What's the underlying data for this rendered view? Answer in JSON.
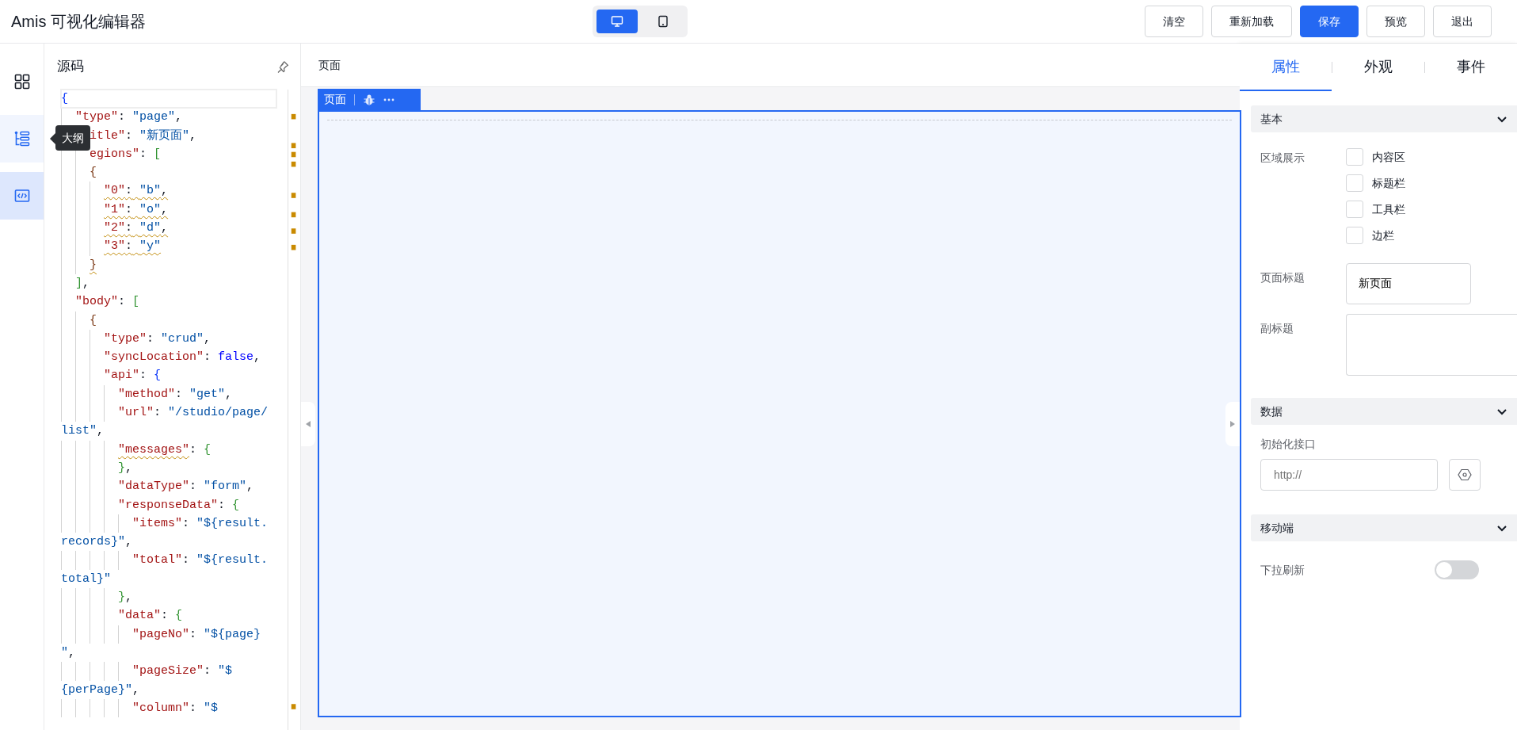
{
  "app": {
    "title": "Amis 可视化编辑器"
  },
  "device_toggle": [
    {
      "kind": "desktop",
      "selected": true
    },
    {
      "kind": "tablet",
      "selected": false
    }
  ],
  "toolbar_buttons": [
    {
      "label": "清空",
      "primary": false
    },
    {
      "label": "重新加载",
      "primary": false
    },
    {
      "label": "保存",
      "primary": true
    },
    {
      "label": "预览",
      "primary": false
    },
    {
      "label": "退出",
      "primary": false
    }
  ],
  "left_rail": [
    {
      "kind": "components",
      "selected": false
    },
    {
      "kind": "outline",
      "selected": false,
      "hovered": true,
      "tooltip": "大纲"
    },
    {
      "kind": "code",
      "selected": true
    }
  ],
  "source_panel": {
    "title": "源码",
    "lines": [
      {
        "text": "{",
        "current": true
      },
      {
        "text": "  \"type\": \"page\","
      },
      {
        "text": "    itle\": \"新页面\",",
        "continued": true
      },
      {
        "text": "    egions\": [",
        "continued": true
      },
      {
        "text": "    {"
      },
      {
        "text": "      \"0\": \"b\",",
        "warning": true
      },
      {
        "text": "      \"1\": \"o\",",
        "warning": true
      },
      {
        "text": "      \"2\": \"d\",",
        "warning": true
      },
      {
        "text": "      \"3\": \"y\"",
        "warning": true
      },
      {
        "text": "    }",
        "warning": true
      },
      {
        "text": "  ],"
      },
      {
        "text": "  \"body\": ["
      },
      {
        "text": "    {"
      },
      {
        "text": "      \"type\": \"crud\","
      },
      {
        "text": "      \"syncLocation\": false,"
      },
      {
        "text": "      \"api\": {"
      },
      {
        "text": "        \"method\": \"get\","
      },
      {
        "text": "        \"url\": \"/studio/page/"
      },
      {
        "text": "list\",",
        "continued": true
      },
      {
        "text": "        \"messages\": {",
        "key_warning": true
      },
      {
        "text": "        },"
      },
      {
        "text": "        \"dataType\": \"form\","
      },
      {
        "text": "        \"responseData\": {"
      },
      {
        "text": "          \"items\": \"${result."
      },
      {
        "text": "records}\",",
        "continued": true
      },
      {
        "text": "          \"total\": \"${result."
      },
      {
        "text": "total}\"",
        "continued": true
      },
      {
        "text": "        },"
      },
      {
        "text": "        \"data\": {"
      },
      {
        "text": "          \"pageNo\": \"${page}"
      },
      {
        "text": "\",",
        "continued": true
      },
      {
        "text": "          \"pageSize\": \"$"
      },
      {
        "text": "{perPage}\",",
        "continued": true
      },
      {
        "text": "          \"column\": \"$"
      }
    ]
  },
  "canvas": {
    "breadcrumb": "页面",
    "selection_tag": {
      "label": "页面"
    }
  },
  "inspector": {
    "tabs": [
      {
        "label": "属性",
        "selected": true
      },
      {
        "label": "外观",
        "selected": false
      },
      {
        "label": "事件",
        "selected": false
      }
    ],
    "sections": [
      {
        "title": "基本",
        "expanded": true,
        "fields": [
          {
            "kind": "checkboxes",
            "label": "区域展示",
            "options": [
              {
                "label": "内容区",
                "checked": false
              },
              {
                "label": "标题栏",
                "checked": false
              },
              {
                "label": "工具栏",
                "checked": false
              },
              {
                "label": "边栏",
                "checked": false
              }
            ]
          },
          {
            "kind": "text",
            "label": "页面标题",
            "value": "新页面"
          },
          {
            "kind": "textarea",
            "label": "副标题"
          }
        ]
      },
      {
        "title": "数据",
        "expanded": true,
        "fields": [
          {
            "kind": "api",
            "label": "初始化接口",
            "placeholder": "http://"
          }
        ]
      },
      {
        "title": "移动端",
        "expanded": true,
        "fields": [
          {
            "kind": "switch",
            "label": "下拉刷新",
            "on": false
          }
        ]
      }
    ]
  }
}
